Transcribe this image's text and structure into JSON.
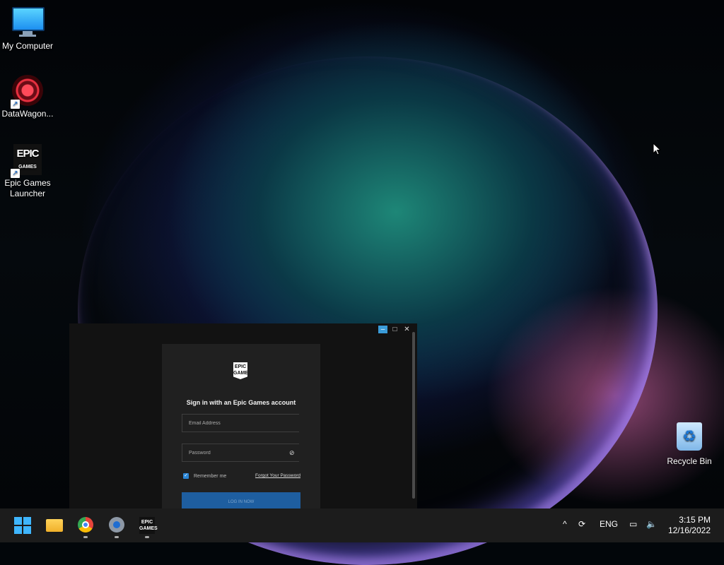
{
  "desktop": {
    "icons": [
      {
        "label": "My Computer"
      },
      {
        "label": "DataWagon..."
      },
      {
        "label": "Epic Games Launcher"
      },
      {
        "label": "Recycle Bin"
      }
    ],
    "epic_logo_line1": "EPIC",
    "epic_logo_line2": "GAMES"
  },
  "epic_window": {
    "controls": {
      "minimize": "–",
      "maximize": "□",
      "close": "✕"
    },
    "logo_text": "EPIC GAMES",
    "title": "Sign in with an Epic Games account",
    "email_placeholder": "Email Address",
    "password_placeholder": "Password",
    "remember_label": "Remember me",
    "forgot_label": "Forgot Your Password",
    "login_button": "LOG IN NOW",
    "checkmark": "✓",
    "eye_glyph": "⊘"
  },
  "taskbar": {
    "tray": {
      "chevron": "^",
      "language": "ENG"
    },
    "clock": {
      "time": "3:15 PM",
      "date": "12/16/2022"
    }
  },
  "colors": {
    "accent": "#2b86d6",
    "taskbar": "#1c1c1c",
    "window_bg": "#121212"
  }
}
